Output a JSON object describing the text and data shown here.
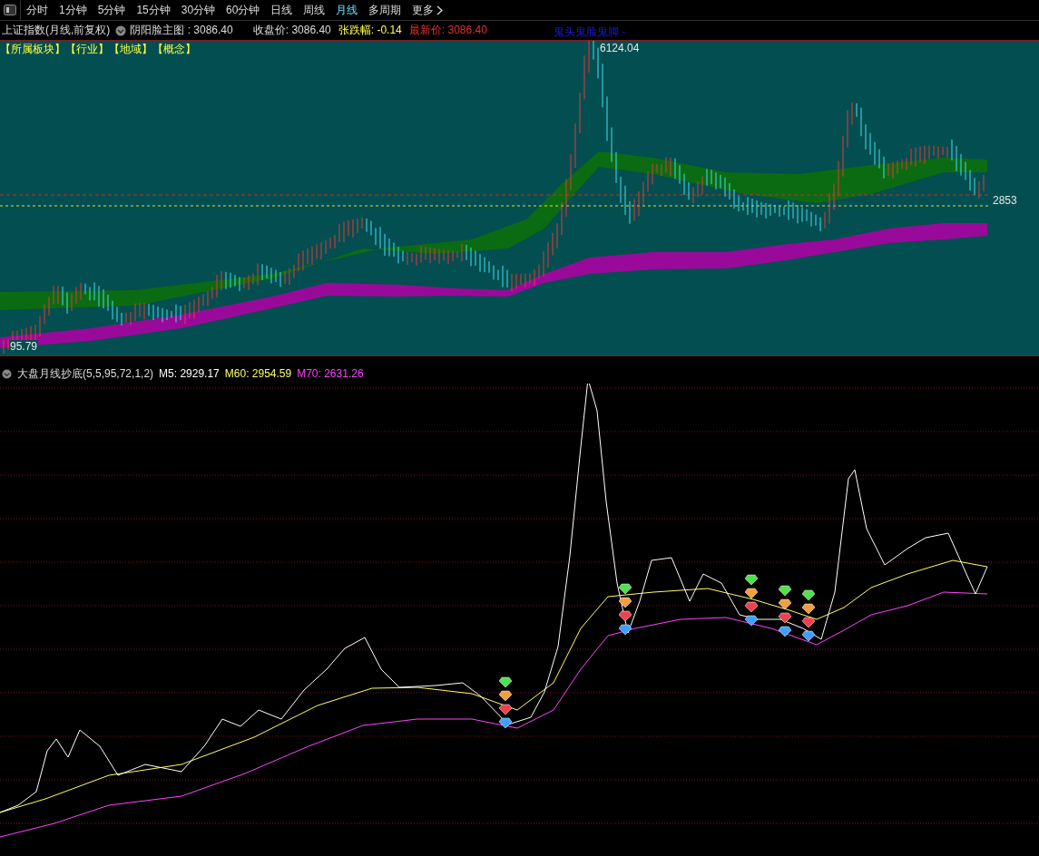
{
  "timeframe_tabs": [
    {
      "label": "分时",
      "selected": false
    },
    {
      "label": "1分钟",
      "selected": false
    },
    {
      "label": "5分钟",
      "selected": false
    },
    {
      "label": "15分钟",
      "selected": false
    },
    {
      "label": "30分钟",
      "selected": false
    },
    {
      "label": "60分钟",
      "selected": false
    },
    {
      "label": "日线",
      "selected": false
    },
    {
      "label": "周线",
      "selected": false
    },
    {
      "label": "月线",
      "selected": true
    },
    {
      "label": "多周期",
      "selected": false
    }
  ],
  "more_button": {
    "label": "更多"
  },
  "info_bar": {
    "security": "上证指数(月线,前复权)",
    "main_chart": "阴阳脸主图 : 3086.40",
    "close": "收盘价: 3086.40",
    "change": "张跌幅: -0.14",
    "latest": "最新价: 3086.40",
    "pattern": "鬼头鬼脸鬼脚 -"
  },
  "main_chart": {
    "tags": [
      "【所属板块】",
      "【行业】",
      "【地域】",
      "【概念】"
    ],
    "high_label": "6124.04",
    "price_label": "2853",
    "low_label": "95.79"
  },
  "indicator": {
    "title": "大盘月线抄底(5,5,95,72,1,2)",
    "values": [
      {
        "label": "M5: 2929.17",
        "color": "#ffffff"
      },
      {
        "label": "M60: 2954.59",
        "color": "#ffff66"
      },
      {
        "label": "M70: 2631.26",
        "color": "#ff44ff"
      }
    ]
  }
}
